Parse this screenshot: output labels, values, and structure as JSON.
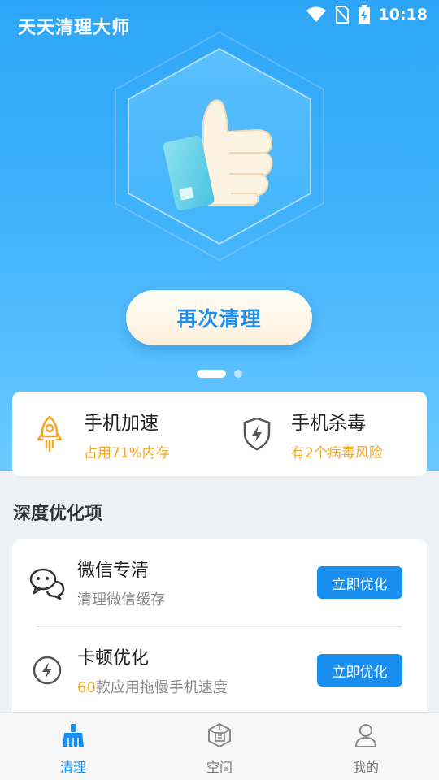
{
  "app": {
    "title": "天天清理大师"
  },
  "status_bar": {
    "time": "10:18"
  },
  "hero": {
    "clean_again_label": "再次清理"
  },
  "carousel": {
    "pages": 2,
    "active_index": 0
  },
  "quick_actions": [
    {
      "title": "手机加速",
      "subtitle": "占用71%内存",
      "icon": "rocket-icon"
    },
    {
      "title": "手机杀毒",
      "subtitle": "有2个病毒风险",
      "icon": "shield-bolt-icon"
    }
  ],
  "deep_optimization": {
    "section_title": "深度优化项",
    "items": [
      {
        "title": "微信专清",
        "subtitle": "清理微信缓存",
        "button": "立即优化",
        "icon": "wechat-icon"
      },
      {
        "title": "卡顿优化",
        "subtitle_highlight": "60",
        "subtitle_rest": "款应用拖慢手机速度",
        "button": "立即优化",
        "icon": "lightning-icon"
      }
    ]
  },
  "bottom_nav": [
    {
      "label": "清理",
      "icon": "broom-icon",
      "active": true
    },
    {
      "label": "空间",
      "icon": "storage-icon",
      "active": false
    },
    {
      "label": "我的",
      "icon": "user-icon",
      "active": false
    }
  ],
  "colors": {
    "primary": "#1a8ff0",
    "accent": "#f5a623",
    "hero_top": "#2ea6f7",
    "hero_bottom": "#6bc9ff"
  }
}
